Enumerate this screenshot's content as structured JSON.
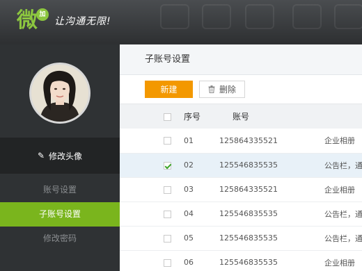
{
  "header": {
    "logo_char": "微",
    "logo_badge": "加",
    "slogan": "让沟通无限!"
  },
  "sidebar": {
    "edit_avatar_label": "修改头像",
    "menu": [
      {
        "label": "账号设置",
        "active": false
      },
      {
        "label": "子账号设置",
        "active": true
      },
      {
        "label": "修改密码",
        "active": false
      }
    ]
  },
  "main": {
    "title": "子账号设置",
    "new_button": "新建",
    "delete_button": "删除",
    "columns": {
      "no": "序号",
      "account": "账号"
    },
    "rows": [
      {
        "no": "01",
        "account": "125864335521",
        "perm": "企业相册",
        "checked": false
      },
      {
        "no": "02",
        "account": "125546835535",
        "perm": "公告栏，通",
        "checked": true
      },
      {
        "no": "03",
        "account": "125864335521",
        "perm": "企业相册",
        "checked": false
      },
      {
        "no": "04",
        "account": "125546835535",
        "perm": "公告栏，通",
        "checked": false
      },
      {
        "no": "05",
        "account": "125546835535",
        "perm": "公告栏，通",
        "checked": false
      },
      {
        "no": "06",
        "account": "125546835535",
        "perm": "企业相册",
        "checked": false
      }
    ]
  },
  "colors": {
    "accent_green": "#7ab51d",
    "accent_orange": "#f39800",
    "sidebar_bg": "#2f3234"
  }
}
